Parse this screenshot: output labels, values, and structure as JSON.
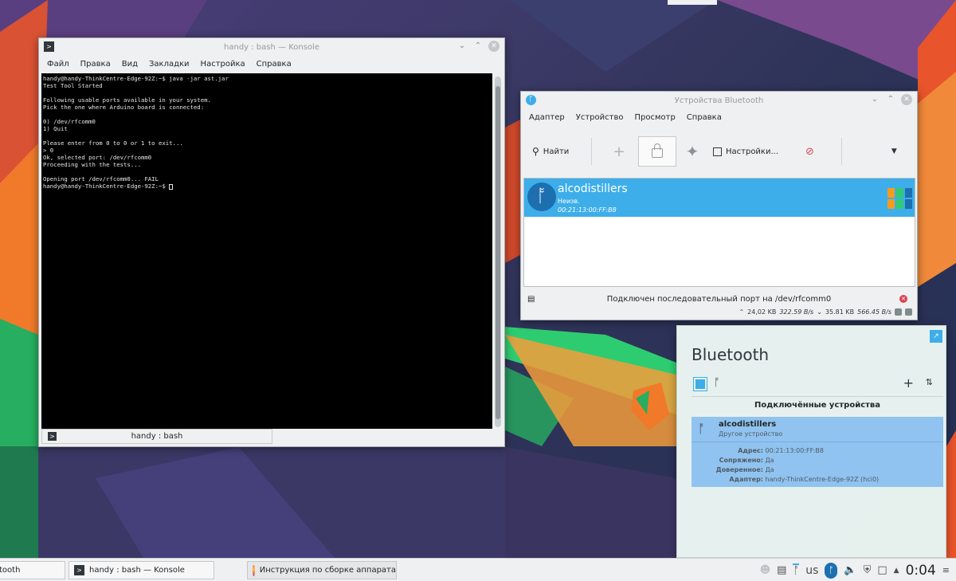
{
  "konsole": {
    "title": "handy : bash — Konsole",
    "menu": [
      "Файл",
      "Правка",
      "Вид",
      "Закладки",
      "Настройка",
      "Справка"
    ],
    "terminal_lines": [
      "handy@handy-ThinkCentre-Edge-92Z:~$ java -jar ast.jar",
      "Test Tool Started",
      "",
      "Following usable ports available in your system.",
      "Pick the one where Arduino board is connected:",
      "",
      "0) /dev/rfcomm0",
      "1) Quit",
      "",
      "Please enter from 0 to 0 or 1 to exit...",
      "> 0",
      "Ok, selected port: /dev/rfcomm0",
      "Proceeding with the tests...",
      "",
      "Opening port /dev/rfcomm0... FAIL",
      "handy@handy-ThinkCentre-Edge-92Z:~$ "
    ],
    "tab_label": "handy : bash"
  },
  "bt_devices": {
    "title": "Устройства Bluetooth",
    "menu": [
      "Адаптер",
      "Устройство",
      "Просмотр",
      "Справка"
    ],
    "find_label": "Найти",
    "settings_label": "Настройки...",
    "device": {
      "name": "alcodistillers",
      "type": "Неизв.",
      "address": "00:21:13:00:FF:B8"
    },
    "status": "Подключен последовательный порт на /dev/rfcomm0",
    "transfer": {
      "up_total": "24,02 KB",
      "up_rate": "322.59 B/s",
      "down_total": "35.81 KB",
      "down_rate": "566.45 B/s"
    }
  },
  "applet": {
    "title": "Bluetooth",
    "section": "Подключённые устройства",
    "device": {
      "name": "alcodistillers",
      "subtitle": "Другое устройство",
      "fields": [
        {
          "label": "Адрес:",
          "value": "00:21:13:00:FF:B8"
        },
        {
          "label": "Сопряжено:",
          "value": "Да"
        },
        {
          "label": "Доверенное:",
          "value": "Да"
        },
        {
          "label": "Адаптер:",
          "value": "handy-ThinkCentre-Edge-92Z (hci0)"
        }
      ]
    }
  },
  "taskbar": {
    "tasks": [
      "tooth",
      "handy : bash — Konsole",
      "Инструкция по сборке аппарата"
    ],
    "keyboard_layout": "us",
    "clock": "0:04"
  },
  "colors": {
    "accent": "#3daee9",
    "selection_applet": "#90c3ef",
    "error": "#da4453"
  }
}
